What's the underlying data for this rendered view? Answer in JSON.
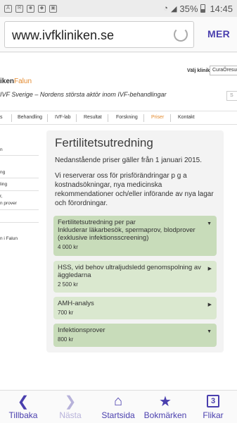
{
  "status_bar": {
    "battery": "35%",
    "time": "14:45",
    "icons": [
      "afi-icon",
      "mail-icon",
      "game-icon",
      "android-icon",
      "image-icon"
    ]
  },
  "browser": {
    "url": "www.ivfkliniken.se",
    "more_label": "MER"
  },
  "site": {
    "brand_prefix": "iken",
    "brand_suffix": "Falun",
    "tagline": "IVF Sverige – Nordens största aktör inom IVF-behandlingar",
    "clinic_label": "Välj klinik:",
    "clinic_value": "CuraÖresund",
    "search_placeholder": "S",
    "nav": [
      "s",
      "Behandling",
      "IVF-lab",
      "Resultat",
      "Forskning",
      "Priser",
      "Kontakt"
    ],
    "active_nav": "Priser",
    "sidenav": [
      "n",
      "ng",
      "ling",
      "r,",
      "n prover",
      "n i Falun"
    ]
  },
  "content": {
    "title": "Fertilitetsutredning",
    "para1": "Nedanstående priser gäller från 1 januari 2015.",
    "para2": "Vi reserverar oss för prisförändringar p g a kostnadsökningar, nya medicinska rekommendationer och/eller införande av nya lagar och förordningar.",
    "items": [
      {
        "title": "Fertilitetsutredning per par",
        "desc": "Inkluderar läkarbesök, spermaprov, blodprover\n(exklusive infektionsscreening)",
        "price": "4 000 kr",
        "arrow": "▼"
      },
      {
        "title": "HSS, vid behov ultraljudsledd genomspolning av äggledarna",
        "desc": "",
        "price": "2 500 kr",
        "arrow": "▶"
      },
      {
        "title": "AMH-analys",
        "desc": "",
        "price": "700 kr",
        "arrow": "▶"
      },
      {
        "title": "Infektionsprover",
        "desc": "",
        "price": "800 kr",
        "arrow": "▼"
      }
    ]
  },
  "toolbar": {
    "back": "Tillbaka",
    "next": "Nästa",
    "home": "Startsida",
    "bookmarks": "Bokmärken",
    "tabs": "Flikar",
    "tab_count": "3"
  },
  "colors": {
    "accent": "#4a3fae",
    "brand_orange": "#e38a2e",
    "accordion_green": "#c8dcba"
  }
}
